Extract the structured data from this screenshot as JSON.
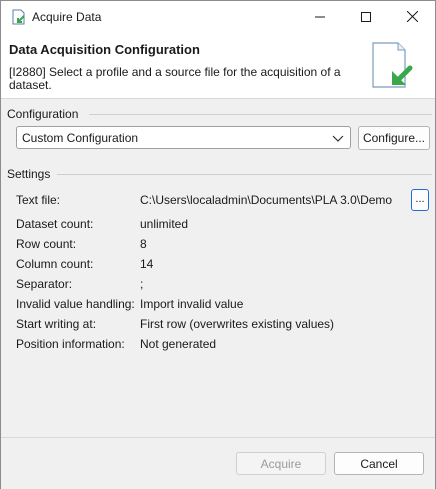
{
  "window": {
    "title": "Acquire Data"
  },
  "header": {
    "title": "Data Acquisition Configuration",
    "description": "[I2880] Select a profile and a source file for the acquisition of a dataset."
  },
  "configuration": {
    "group_label": "Configuration",
    "selected": "Custom Configuration",
    "configure_label": "Configure..."
  },
  "settings": {
    "group_label": "Settings",
    "text_file_label": "Text file:",
    "text_file_value": "C:\\Users\\localadmin\\Documents\\PLA 3.0\\Demo",
    "browse_label": "...",
    "rows": [
      {
        "label": "Dataset count:",
        "value": "unlimited"
      },
      {
        "label": "Row count:",
        "value": "8"
      },
      {
        "label": "Column count:",
        "value": "14"
      },
      {
        "label": "Separator:",
        "value": ";"
      },
      {
        "label": "Invalid value handling:",
        "value": "Import invalid value"
      },
      {
        "label": "Start writing at:",
        "value": "First row (overwrites existing values)"
      },
      {
        "label": "Position information:",
        "value": "Not generated"
      }
    ]
  },
  "footer": {
    "acquire_label": "Acquire",
    "cancel_label": "Cancel"
  },
  "colors": {
    "accent": "#1f6fd1",
    "icon_green": "#3aa84a"
  },
  "icons": {
    "app": "acquire-data-icon",
    "minimize": "minimize-icon",
    "maximize": "maximize-icon",
    "close": "close-icon",
    "header": "document-import-icon",
    "dropdown": "chevron-down-icon"
  }
}
